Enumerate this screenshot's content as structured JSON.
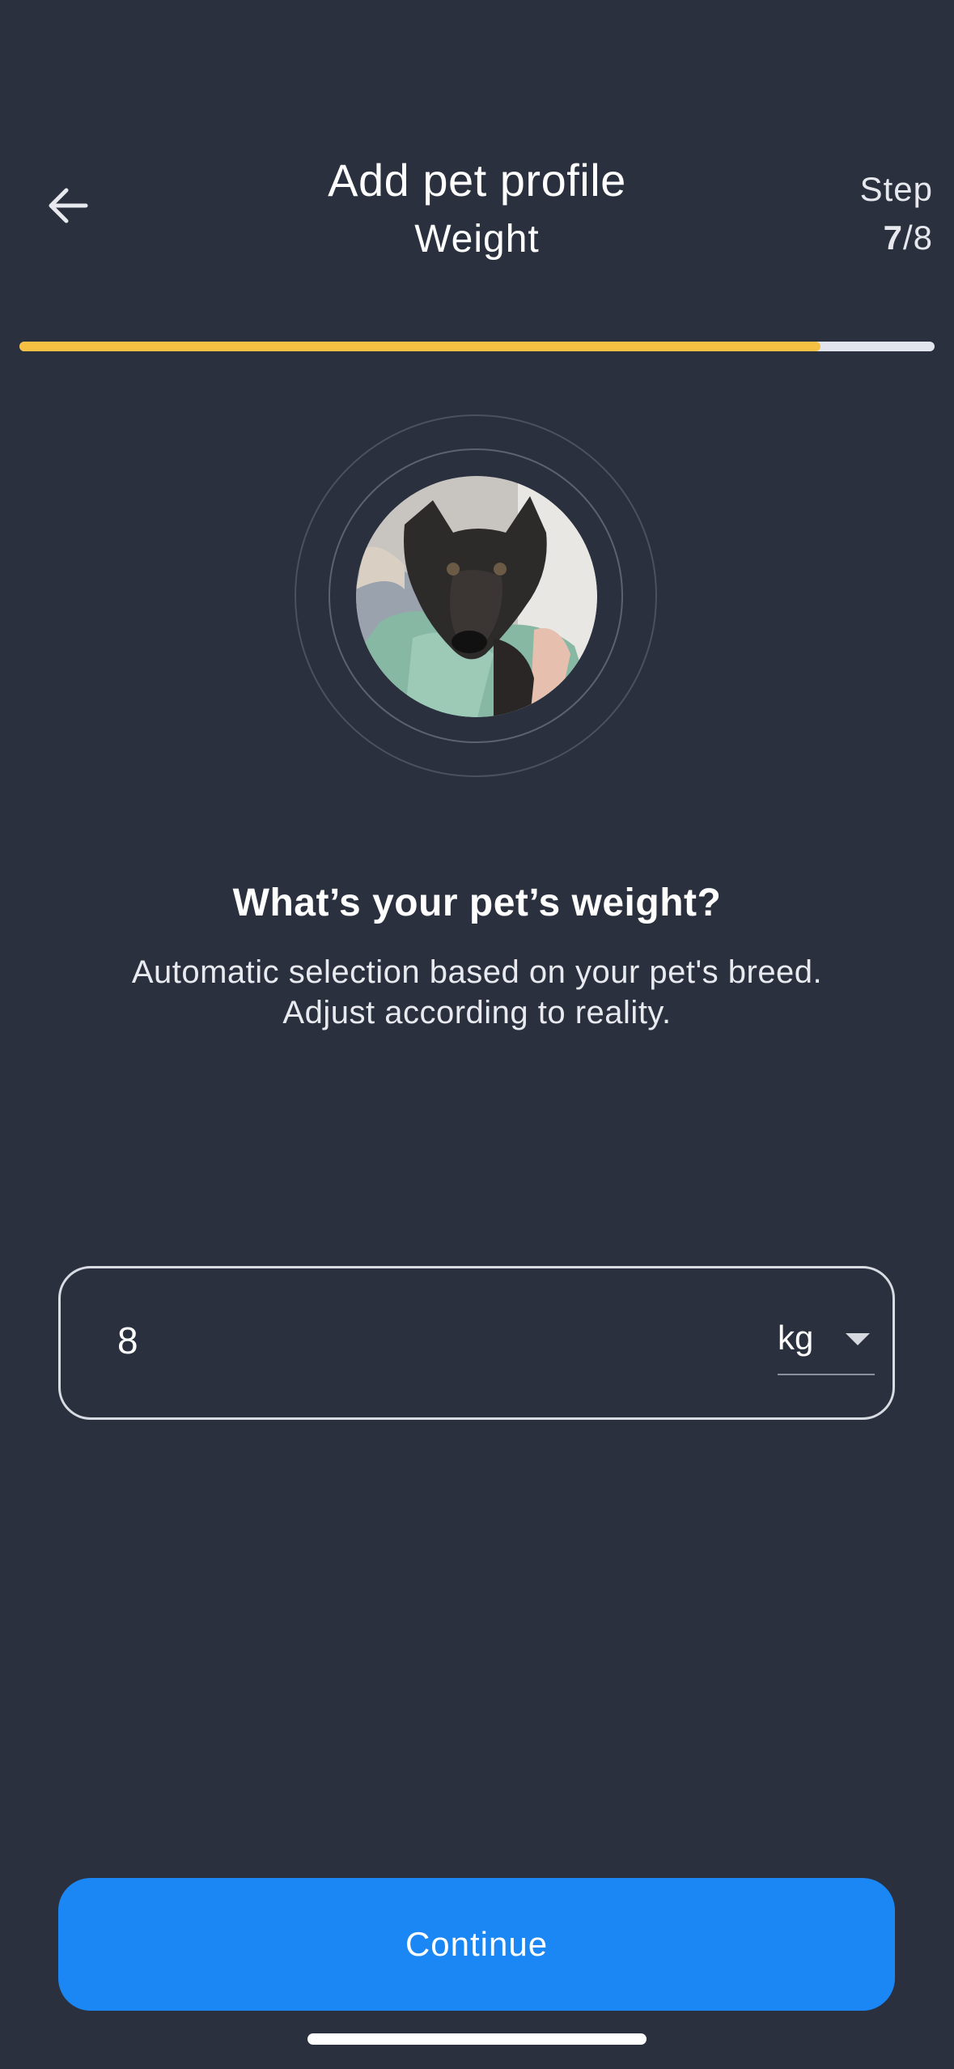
{
  "header": {
    "back_icon": "arrow-left-icon",
    "title": "Add pet profile",
    "subtitle": "Weight",
    "step_label": "Step",
    "step_current": "7",
    "step_separator": "/",
    "step_total": "8"
  },
  "progress": {
    "fraction": 0.875,
    "fill_color": "#f6c142",
    "track_color": "#e3e5ee"
  },
  "avatar": {
    "icon": "pet-photo"
  },
  "question": {
    "title": "What’s your pet’s weight?",
    "hint_line1": "Automatic selection based on your pet's breed.",
    "hint_line2": "Adjust according to reality."
  },
  "weight_input": {
    "value": "8",
    "unit": "kg",
    "unit_icon": "caret-down-icon"
  },
  "actions": {
    "continue_label": "Continue",
    "button_color": "#1b87f5"
  },
  "colors": {
    "background": "#2a303e"
  }
}
